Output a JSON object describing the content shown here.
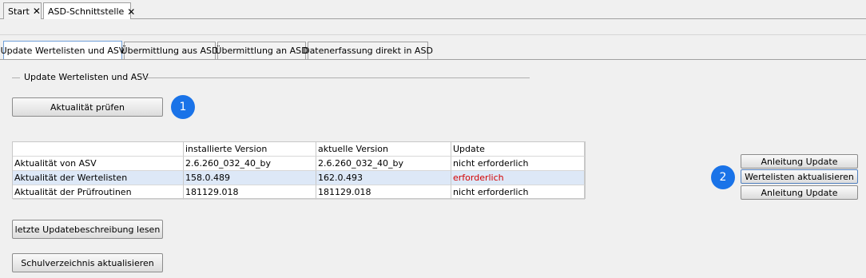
{
  "doc_tabs": [
    {
      "label": "Start"
    },
    {
      "label": "ASD-Schnittstelle"
    }
  ],
  "tabs": [
    {
      "label": "Update Wertelisten und ASV"
    },
    {
      "label": "Übermittlung aus ASD"
    },
    {
      "label": "Übermittlung an ASD"
    },
    {
      "label": "Datenerfassung direkt in ASD"
    }
  ],
  "group": {
    "title": "Update Wertelisten und ASV"
  },
  "buttons": {
    "check_update": "Aktualität prüfen",
    "read_description": "letzte Updatebeschreibung lesen",
    "update_school_dir": "Schulverzeichnis aktualisieren",
    "update_instructions_1": "Anleitung Update",
    "update_value_lists": "Wertelisten aktualisieren",
    "update_instructions_2": "Anleitung Update"
  },
  "badges": {
    "one": "1",
    "two": "2"
  },
  "table": {
    "headers": [
      "",
      "installierte Version",
      "aktuelle Version",
      "Update"
    ],
    "rows": [
      {
        "name": "Aktualität von ASV",
        "installed": "2.6.260_032_40_by",
        "current": "2.6.260_032_40_by",
        "update": "nicht erforderlich"
      },
      {
        "name": "Aktualität der Wertelisten",
        "installed": "158.0.489",
        "current": "162.0.493",
        "update": "erforderlich"
      },
      {
        "name": "Aktualität der Prüfroutinen",
        "installed": "181129.018",
        "current": "181129.018",
        "update": "nicht erforderlich"
      }
    ]
  },
  "colors": {
    "accent": "#1a73e8",
    "required": "#d40000",
    "selected_row": "#dde8f7"
  }
}
